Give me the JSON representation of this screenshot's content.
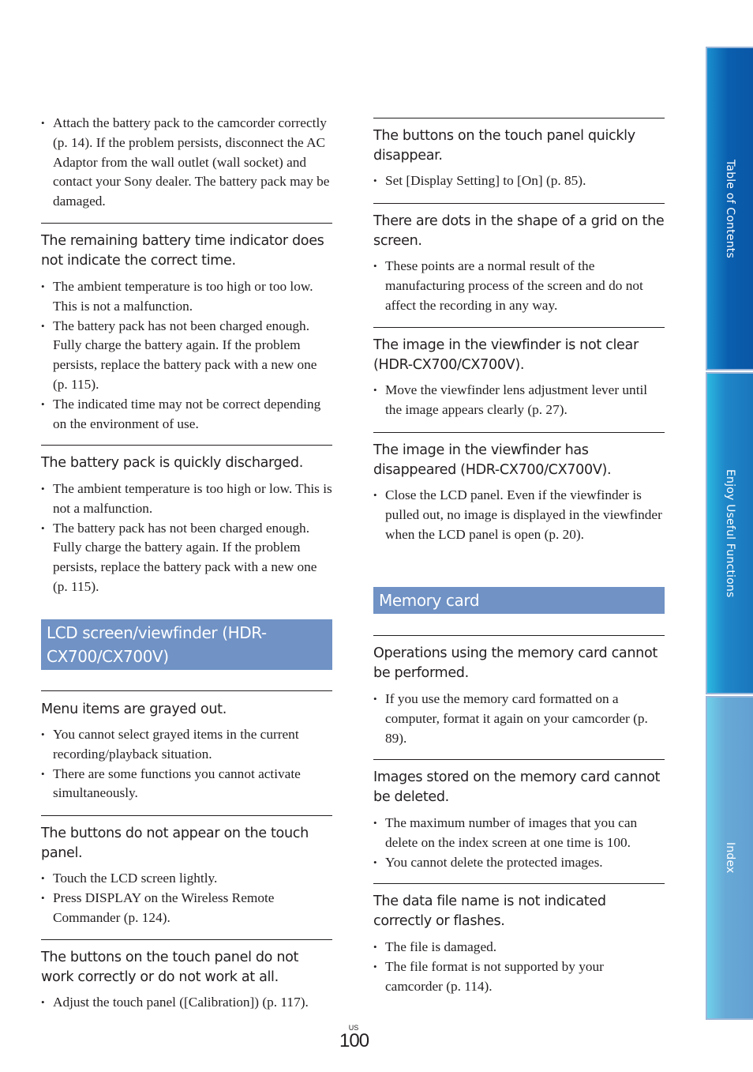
{
  "page": {
    "region_code": "US",
    "page_number": "100"
  },
  "side_tabs": [
    {
      "label": "Table of Contents"
    },
    {
      "label": "Enjoy Useful Functions"
    },
    {
      "label": "Index"
    }
  ],
  "colors": {
    "section_bar": "#7092c5",
    "tab_toc": "#0a5fae",
    "tab_enjoy": "#1f86c8",
    "tab_index": "#67a9d6",
    "text": "#231f20"
  },
  "left_column": {
    "intro_bullets": [
      "Attach the battery pack to the camcorder correctly (p. 14). If the problem persists, disconnect the AC Adaptor from the wall outlet (wall socket) and contact your Sony dealer. The battery pack may be damaged."
    ],
    "items": [
      {
        "heading": "The remaining battery time indicator does not indicate the correct time.",
        "bullets": [
          "The ambient temperature is too high or too low. This is not a malfunction.",
          "The battery pack has not been charged enough. Fully charge the battery again. If the problem persists, replace the battery pack with a new one (p. 115).",
          "The indicated time may not be correct depending on the environment of use."
        ]
      },
      {
        "heading": "The battery pack is quickly discharged.",
        "bullets": [
          "The ambient temperature is too high or low. This is not a malfunction.",
          "The battery pack has not been charged enough. Fully charge the battery again. If the problem persists, replace the battery pack with a new one (p. 115)."
        ]
      }
    ],
    "section_title": "LCD screen/viewfinder (HDR-CX700/CX700V)",
    "section_items": [
      {
        "heading": "Menu items are grayed out.",
        "bullets": [
          "You cannot select grayed items in the current recording/playback situation.",
          "There are some functions you cannot activate simultaneously."
        ]
      },
      {
        "heading": "The buttons do not appear on the touch panel.",
        "bullets": [
          "Touch the LCD screen lightly.",
          "Press DISPLAY on the Wireless Remote Commander (p. 124)."
        ]
      },
      {
        "heading": "The buttons on the touch panel do not work correctly or do not work at all.",
        "bullets": [
          "Adjust the touch panel ([Calibration]) (p. 117)."
        ]
      }
    ]
  },
  "right_column": {
    "items": [
      {
        "heading": "The buttons on the touch panel quickly disappear.",
        "bullets": [
          "Set [Display Setting] to [On] (p. 85)."
        ]
      },
      {
        "heading": "There are dots in the shape of a grid on the screen.",
        "bullets": [
          "These points are a normal result of the manufacturing process of the screen and do not affect the recording in any way."
        ]
      },
      {
        "heading": "The image in the viewfinder is not clear (HDR-CX700/CX700V).",
        "bullets": [
          "Move the viewfinder lens adjustment lever until the image appears clearly (p. 27)."
        ]
      },
      {
        "heading": "The image in the viewfinder has disappeared (HDR-CX700/CX700V).",
        "bullets": [
          "Close the LCD panel. Even if the viewfinder is pulled out, no image is displayed in the viewfinder when the LCD panel is open (p. 20)."
        ]
      }
    ],
    "section_title": "Memory card",
    "section_items": [
      {
        "heading": "Operations using the memory card cannot be performed.",
        "bullets": [
          "If you use the memory card formatted on a computer, format it again on your camcorder (p. 89)."
        ]
      },
      {
        "heading": "Images stored on the memory card cannot be deleted.",
        "bullets": [
          "The maximum number of images that you can delete on the index screen at one time is 100.",
          "You cannot delete the protected images."
        ]
      },
      {
        "heading": "The data file name is not indicated correctly or flashes.",
        "bullets": [
          "The file is damaged.",
          "The file format is not supported by your camcorder (p. 114)."
        ]
      }
    ]
  }
}
